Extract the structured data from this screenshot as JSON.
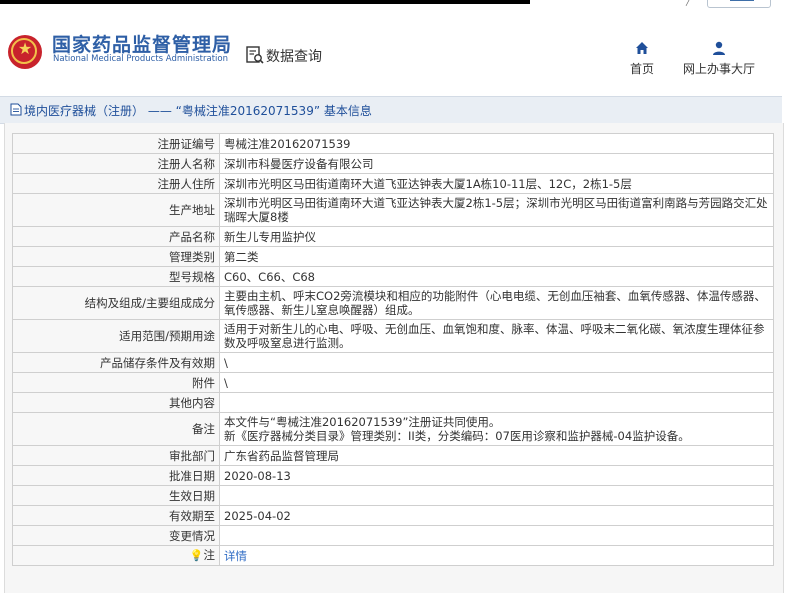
{
  "header": {
    "title": "国家药品监督管理局",
    "subtitle": "National Medical Products Administration",
    "query_label": "数据查询",
    "nav": [
      {
        "label": "首页",
        "icon": "home-icon"
      },
      {
        "label": "网上办事大厅",
        "icon": "user-icon"
      }
    ]
  },
  "breadcrumb": {
    "text": "境内医疗器械（注册） —— “粤械注准20162071539” 基本信息"
  },
  "record": {
    "rows": [
      {
        "label": "注册证编号",
        "value": "粤械注准20162071539"
      },
      {
        "label": "注册人名称",
        "value": "深圳市科曼医疗设备有限公司"
      },
      {
        "label": "注册人住所",
        "value": "深圳市光明区马田街道南环大道飞亚达钟表大厦1A栋10-11层、12C，2栋1-5层"
      },
      {
        "label": "生产地址",
        "value": "深圳市光明区马田街道南环大道飞亚达钟表大厦2栋1-5层；深圳市光明区马田街道富利南路与芳园路交汇处瑞晖大厦8楼"
      },
      {
        "label": "产品名称",
        "value": "新生儿专用监护仪"
      },
      {
        "label": "管理类别",
        "value": "第二类"
      },
      {
        "label": "型号规格",
        "value": "C60、C66、C68"
      },
      {
        "label": "结构及组成/主要组成成分",
        "value": "主要由主机、呼末CO2旁流模块和相应的功能附件（心电电缆、无创血压袖套、血氧传感器、体温传感器、氧传感器、新生儿窒息唤醒器）组成。"
      },
      {
        "label": "适用范围/预期用途",
        "value": "适用于对新生儿的心电、呼吸、无创血压、血氧饱和度、脉率、体温、呼吸末二氧化碳、氧浓度生理体征参数及呼吸窒息进行监测。"
      },
      {
        "label": "产品储存条件及有效期",
        "value": "\\"
      },
      {
        "label": "附件",
        "value": "\\"
      },
      {
        "label": "其他内容",
        "value": ""
      },
      {
        "label": "备注",
        "value_lines": [
          "本文件与“粤械注准20162071539”注册证共同使用。",
          "新《医疗器械分类目录》管理类别：II类，分类编码：07医用诊察和监护器械-04监护设备。"
        ]
      },
      {
        "label": "审批部门",
        "value": "广东省药品监督管理局"
      },
      {
        "label": "批准日期",
        "value": "2020-08-13"
      },
      {
        "label": "生效日期",
        "value": ""
      },
      {
        "label": "有效期至",
        "value": "2025-04-02"
      },
      {
        "label": "变更情况",
        "value": ""
      },
      {
        "label": "注",
        "value": "详情",
        "icon": "lightbulb-icon"
      }
    ]
  },
  "colors": {
    "brand_blue": "#2e5fa6",
    "link_blue": "#2e6bc4",
    "crumb_bg": "#e9eef4",
    "logo_red": "#c8232c"
  }
}
